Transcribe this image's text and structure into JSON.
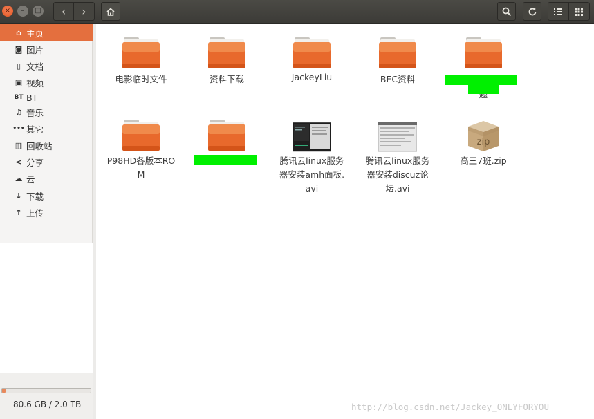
{
  "window": {
    "close_glyph": "×",
    "min_glyph": "–",
    "max_glyph": "□"
  },
  "toolbar": {
    "back_glyph": "‹",
    "forward_glyph": "›"
  },
  "sidebar": {
    "items": [
      {
        "label": "主页",
        "icon": "home-icon",
        "glyph": "⌂"
      },
      {
        "label": "图片",
        "icon": "camera-icon",
        "glyph": "◙"
      },
      {
        "label": "文档",
        "icon": "document-icon",
        "glyph": "▯"
      },
      {
        "label": "视频",
        "icon": "video-icon",
        "glyph": "▣"
      },
      {
        "label": "BT",
        "icon": "bt-icon",
        "glyph": "BT"
      },
      {
        "label": "音乐",
        "icon": "music-icon",
        "glyph": "♫"
      },
      {
        "label": "其它",
        "icon": "more-icon",
        "glyph": "•••"
      },
      {
        "label": "回收站",
        "icon": "trash-icon",
        "glyph": "▥"
      },
      {
        "label": "分享",
        "icon": "share-icon",
        "glyph": "<"
      },
      {
        "label": "云",
        "icon": "cloud-icon",
        "glyph": "☁"
      },
      {
        "label": "下载",
        "icon": "download-icon",
        "glyph": "↓"
      },
      {
        "label": "上传",
        "icon": "upload-icon",
        "glyph": "↑"
      }
    ],
    "storage": {
      "text": "80.6 GB / 2.0 TB",
      "used_fraction": 0.04
    }
  },
  "files": [
    {
      "name": "电影临时文件",
      "type": "folder"
    },
    {
      "name": "资料下载",
      "type": "folder"
    },
    {
      "name": "JackeyLiu",
      "type": "folder"
    },
    {
      "name": "BEC资料",
      "type": "folder"
    },
    {
      "name": "",
      "type": "folder",
      "redacted": true,
      "visible_fragment": "题"
    },
    {
      "name": "P98HD各版本ROM",
      "type": "folder"
    },
    {
      "name": "",
      "type": "folder",
      "redacted": true
    },
    {
      "name": "腾讯云linux服务器安装amh面板.avi",
      "type": "video"
    },
    {
      "name": "腾讯云linux服务器安装discuz论坛.avi",
      "type": "video"
    },
    {
      "name": "高三7班.zip",
      "type": "zip",
      "icon_text": "zip"
    }
  ],
  "watermark": "http://blog.csdn.net/Jackey_ONLYFORYOU",
  "colors": {
    "accent": "#e46f3e",
    "header": "#3c3b37",
    "folder": "#e8692c",
    "redaction": "#00f000"
  }
}
